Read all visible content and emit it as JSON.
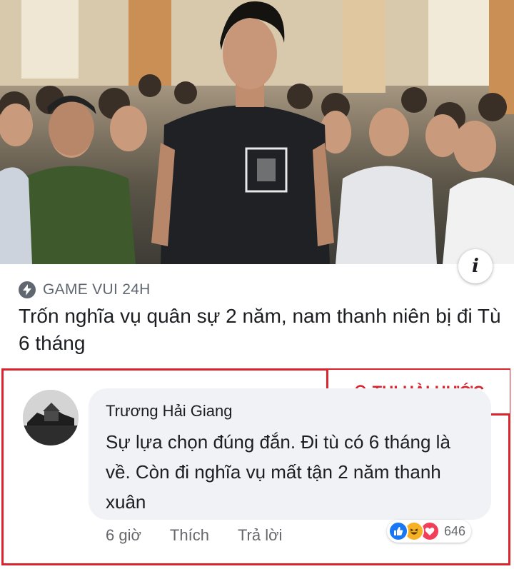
{
  "post": {
    "source": "GAME VUI 24H",
    "headline": "Trốn nghĩa vụ quân sự 2 năm, nam thanh niên bị đi Tù 6 tháng",
    "info_glyph": "i"
  },
  "watermark": {
    "text": "TUI HÀI HƯỚC",
    "color": "#d9242e"
  },
  "comment": {
    "author": "Trương Hải Giang",
    "text": "Sự lựa chọn đúng đắn. Đi tù có 6 tháng là về. Còn đi nghĩa vụ mất tận 2 năm thanh xuân",
    "time": "6 giờ",
    "like_label": "Thích",
    "reply_label": "Trả lời",
    "reactions": {
      "types": [
        "like",
        "haha",
        "love"
      ],
      "count": "646"
    }
  }
}
